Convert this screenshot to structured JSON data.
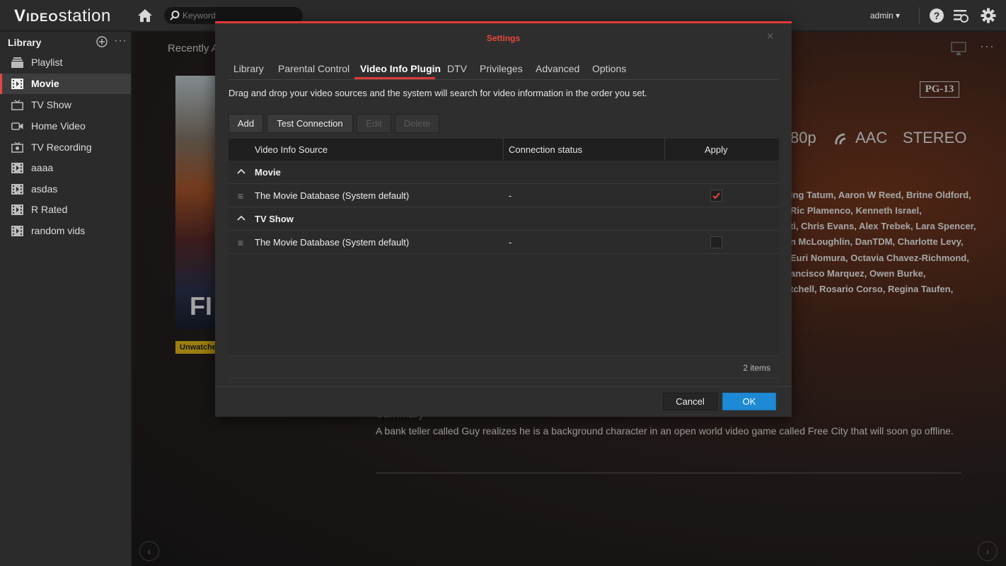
{
  "app": {
    "logo_prefix": "V",
    "logo_mid": "IDEO",
    "logo_suffix": "station"
  },
  "topbar": {
    "search_placeholder": "Keyword",
    "user": "admin ▾",
    "icons": [
      "home-icon",
      "search-icon",
      "help-icon",
      "task-list-icon",
      "gear-icon"
    ]
  },
  "sidebar": {
    "header": "Library",
    "more": "···",
    "items": [
      {
        "label": "Playlist",
        "icon": "playlist-icon"
      },
      {
        "label": "Movie",
        "icon": "movie-icon",
        "active": true
      },
      {
        "label": "TV Show",
        "icon": "tv-icon"
      },
      {
        "label": "Home Video",
        "icon": "camera-icon"
      },
      {
        "label": "TV Recording",
        "icon": "recording-icon"
      },
      {
        "label": "aaaa",
        "icon": "movie-icon"
      },
      {
        "label": "asdas",
        "icon": "movie-icon"
      },
      {
        "label": "R Rated",
        "icon": "movie-icon"
      },
      {
        "label": "random vids",
        "icon": "movie-icon"
      }
    ]
  },
  "background": {
    "recent_label": "Recently A",
    "poster_text": "FI",
    "unwatched": "Unwatche",
    "rating": "PG-13",
    "formats": {
      "resolution": "80p",
      "audio": "AAC",
      "channels": "STEREO"
    },
    "cast_lines": [
      "ing Tatum, Aaron W Reed, Britne Oldford,",
      "Ric Plamenco, Kenneth Israel,",
      "ti, Chris Evans, Alex Trebek, Lara Spencer,",
      "n McLoughlin, DanTDM, Charlotte Levy,",
      " Euri Nomura, Octavia Chavez-Richmond,",
      "ancisco Marquez, Owen Burke,",
      "tchell, Rosario Corso, Regina Taufen,"
    ],
    "summary_title": "Summary",
    "summary_text": "A bank teller called Guy realizes he is a background character in an open world video game called Free City that will soon go offline.",
    "more": "···"
  },
  "modal": {
    "title": "Settings",
    "close": "×",
    "tabs": [
      "Library",
      "Parental Control",
      "Video Info Plugin",
      "DTV",
      "Privileges",
      "Advanced",
      "Options"
    ],
    "active_tab": "Video Info Plugin",
    "instructions": "Drag and drop your video sources and the system will search for video information in the order you set.",
    "toolbar": {
      "add": "Add",
      "test": "Test Connection",
      "edit": "Edit",
      "delete": "Delete"
    },
    "columns": [
      "Video Info Source",
      "Connection status",
      "Apply"
    ],
    "groups": [
      {
        "label": "Movie",
        "rows": [
          {
            "source": "The Movie Database (System default)",
            "status": "-",
            "apply": true
          }
        ]
      },
      {
        "label": "TV Show",
        "rows": [
          {
            "source": "The Movie Database (System default)",
            "status": "-",
            "apply": false
          }
        ]
      }
    ],
    "item_count": "2 items",
    "cancel": "Cancel",
    "ok": "OK"
  },
  "colors": {
    "accent": "#e03a3a",
    "primary_button": "#1e8ad6",
    "checkmark": "#e0403a"
  }
}
